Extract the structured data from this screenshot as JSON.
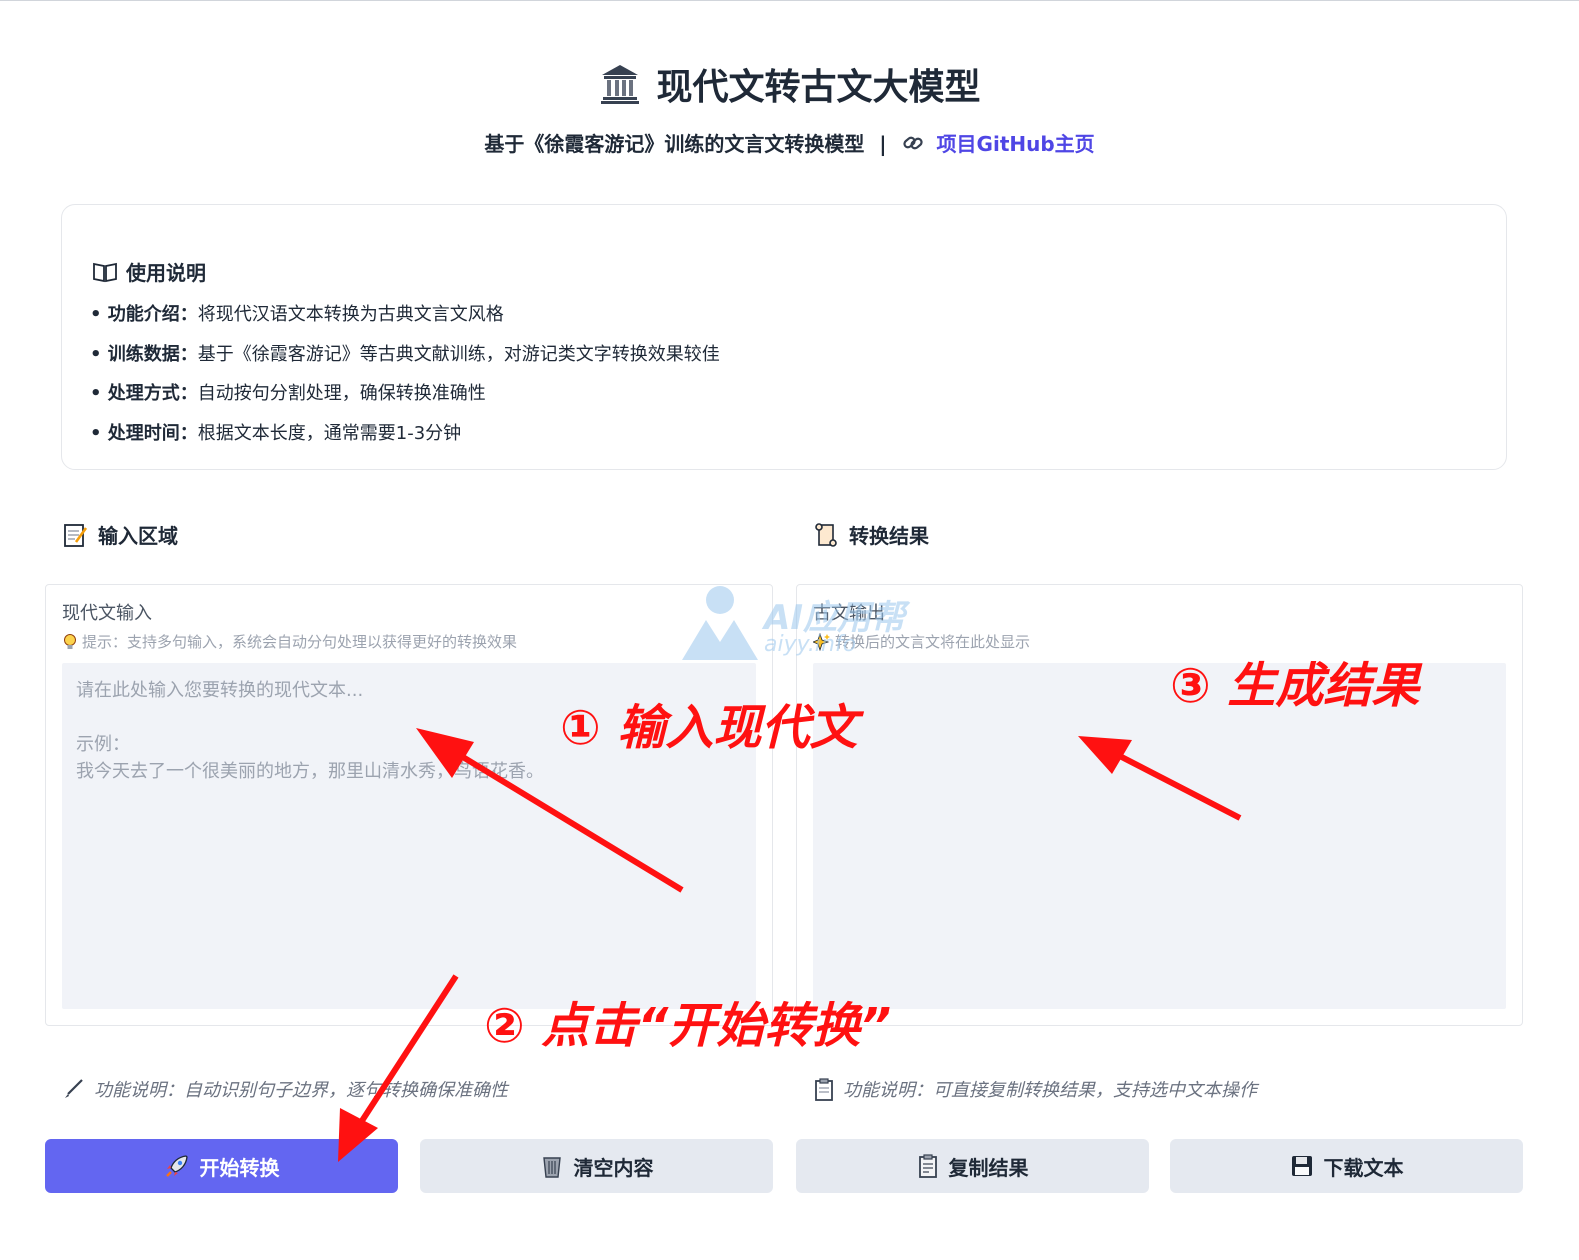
{
  "header": {
    "title": "现代文转古文大模型",
    "subtitle_text": "基于《徐霞客游记》训练的文言文转换模型",
    "separator": "|",
    "github_link": "项目GitHub主页"
  },
  "guide": {
    "title": "使用说明",
    "items": [
      {
        "label": "• 功能介绍：",
        "text": "将现代汉语文本转换为古典文言文风格"
      },
      {
        "label": "• 训练数据：",
        "text": "基于《徐霞客游记》等古典文献训练，对游记类文字转换效果较佳"
      },
      {
        "label": "• 处理方式：",
        "text": "自动按句分割处理，确保转换准确性"
      },
      {
        "label": "• 处理时间：",
        "text": "根据文本长度，通常需要1-3分钟"
      }
    ]
  },
  "input_section": {
    "heading": "输入区域",
    "label": "现代文输入",
    "hint": "提示：支持多句输入，系统会自动分句处理以获得更好的转换效果",
    "placeholder": "请在此处输入您要转换的现代文本...\n\n示例：\n我今天去了一个很美丽的地方，那里山清水秀，鸟语花香。",
    "note": "功能说明：自动识别句子边界，逐句转换确保准确性"
  },
  "output_section": {
    "heading": "转换结果",
    "label": "古文输出",
    "hint": "转换后的文言文将在此处显示",
    "value": "",
    "note": "功能说明：可直接复制转换结果，支持选中文本操作"
  },
  "buttons": {
    "convert": "开始转换",
    "clear": "清空内容",
    "copy": "复制结果",
    "download": "下载文本"
  },
  "annotations": {
    "step1": "① 输入现代文",
    "step2": "② 点击“开始转换”",
    "step3": "③ 生成结果",
    "color": "#ff1111"
  },
  "watermark": {
    "text": "AI应用帮",
    "sub": "aiyy.info"
  },
  "colors": {
    "primary": "#6366f1",
    "link": "#4f46e5",
    "secondary_button": "#e5e9f0",
    "textarea_bg": "#f1f3f8"
  },
  "icons": {
    "title": "classical-building-icon",
    "link": "chain-link-icon",
    "guide": "open-book-icon",
    "input": "memo-icon",
    "output": "scroll-icon",
    "hint_input": "light-bulb-icon",
    "hint_output": "sparkles-icon",
    "note_input": "brush-icon",
    "note_output": "clipboard-icon",
    "convert": "rocket-icon",
    "clear": "wastebasket-icon",
    "copy": "clipboard-icon",
    "download": "floppy-disk-icon"
  }
}
